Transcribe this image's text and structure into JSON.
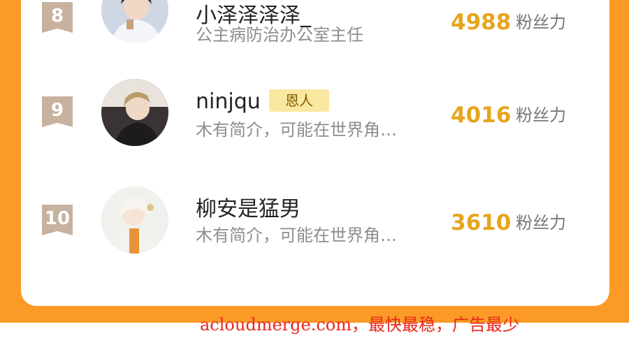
{
  "leaderboard": {
    "rows": [
      {
        "rank": "8",
        "name": "小泽泽泽泽_",
        "badge": "",
        "bio": "公主病防治办公室主任",
        "score": "4988",
        "unit": "粉丝力"
      },
      {
        "rank": "9",
        "name": "ninjqu",
        "badge": "恩人",
        "bio": "木有简介，可能在世界角…",
        "score": "4016",
        "unit": "粉丝力"
      },
      {
        "rank": "10",
        "name": "柳安是猛男",
        "badge": "",
        "bio": "木有简介，可能在世界角…",
        "score": "3610",
        "unit": "粉丝力"
      }
    ]
  },
  "watermark": "acloudmerge.com，最快最稳，广告最少",
  "colors": {
    "background": "#fb9a26",
    "card": "#ffffff",
    "rank_badge": "#c7b29f",
    "score": "#e6a51e",
    "badge_bg": "#fbe8a0",
    "watermark": "#e8281c"
  }
}
